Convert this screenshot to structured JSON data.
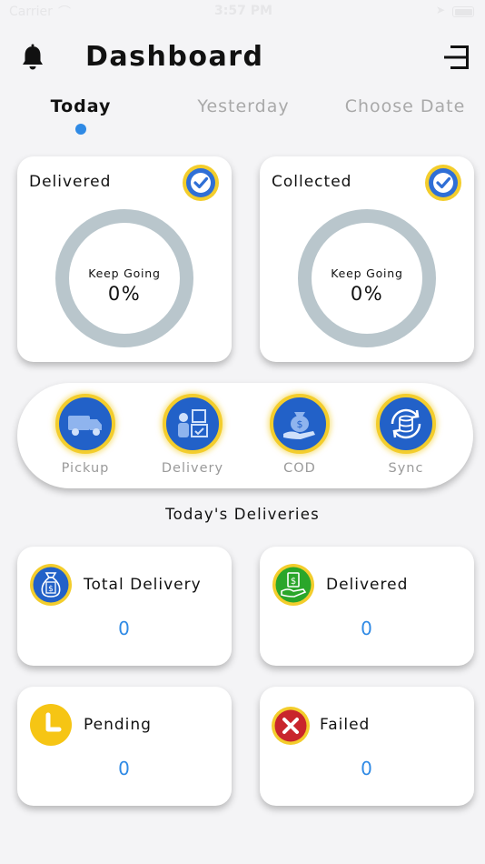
{
  "status_bar": {
    "carrier": "Carrier",
    "time": "3:57 PM"
  },
  "header": {
    "title": "Dashboard"
  },
  "tabs": [
    {
      "label": "Today",
      "active": true
    },
    {
      "label": "Yesterday",
      "active": false
    },
    {
      "label": "Choose Date",
      "active": false
    }
  ],
  "progress_cards": [
    {
      "title": "Delivered",
      "caption": "Keep Going",
      "value": "0%"
    },
    {
      "title": "Collected",
      "caption": "Keep Going",
      "value": "0%"
    }
  ],
  "actions": [
    {
      "label": "Pickup",
      "icon": "truck-icon"
    },
    {
      "label": "Delivery",
      "icon": "delivery-person-icon"
    },
    {
      "label": "COD",
      "icon": "cash-hand-icon"
    },
    {
      "label": "Sync",
      "icon": "sync-icon"
    }
  ],
  "section_title": "Today's Deliveries",
  "stats": [
    {
      "label": "Total Delivery",
      "value": "0",
      "icon": "money-bag-icon"
    },
    {
      "label": "Delivered",
      "value": "0",
      "icon": "money-hand-icon"
    },
    {
      "label": "Pending",
      "value": "0",
      "icon": "clock-icon"
    },
    {
      "label": "Failed",
      "value": "0",
      "icon": "x-icon"
    }
  ],
  "colors": {
    "accent_blue": "#2f8ae5",
    "icon_blue": "#2261c8",
    "icon_ring_yellow": "#f3cd2c",
    "progress_ring": "#b9c6cc",
    "delivered_green": "#2aa62a",
    "failed_red": "#c9252c",
    "pending_yellow": "#f6c514"
  }
}
